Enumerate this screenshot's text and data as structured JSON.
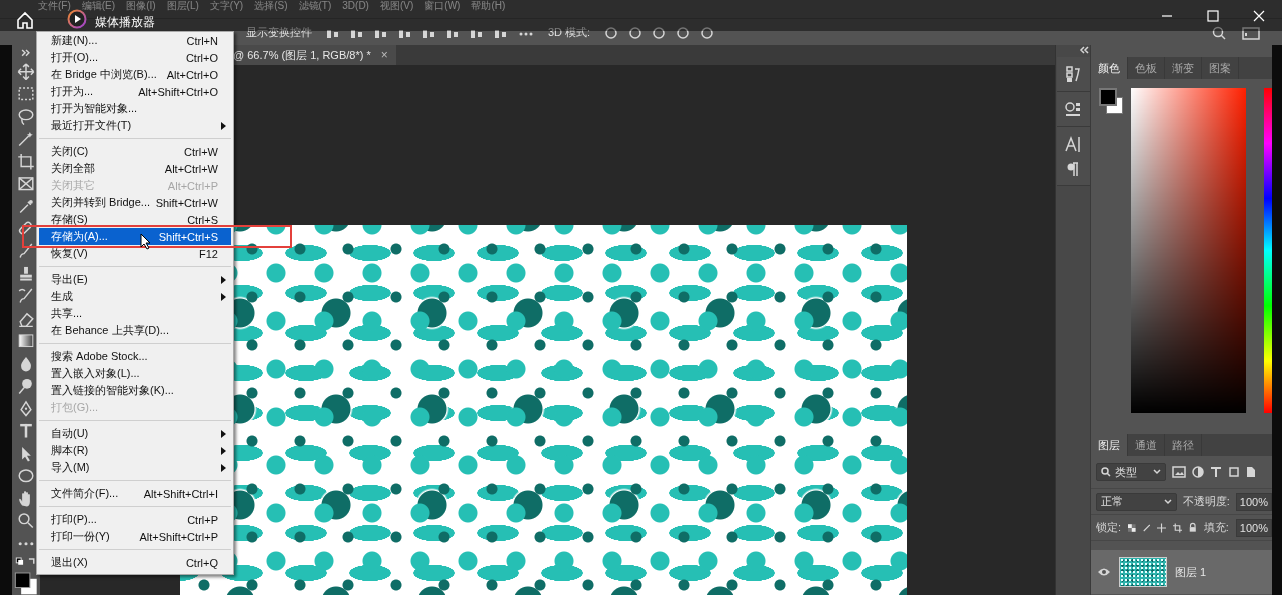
{
  "menubar": [
    {
      "label": "文件(F)"
    },
    {
      "label": "编辑(E)"
    },
    {
      "label": "图像(I)"
    },
    {
      "label": "图层(L)"
    },
    {
      "label": "文字(Y)"
    },
    {
      "label": "选择(S)"
    },
    {
      "label": "滤镜(T)"
    },
    {
      "label": "3D(D)"
    },
    {
      "label": "视图(V)"
    },
    {
      "label": "窗口(W)"
    },
    {
      "label": "帮助(H)"
    }
  ],
  "media_player": {
    "title": "媒体播放器"
  },
  "options_bar": {
    "transform_label": "显示变换控件",
    "mode_label": "3D 模式:"
  },
  "document_tab": {
    "title": "@ 66.7% (图层 1, RGB/8*) *",
    "close": "×"
  },
  "file_menu": {
    "items": [
      {
        "kind": "item",
        "label": "新建(N)...",
        "shortcut": "Ctrl+N",
        "disabled": false,
        "selected": false
      },
      {
        "kind": "item",
        "label": "打开(O)...",
        "shortcut": "Ctrl+O",
        "disabled": false,
        "selected": false
      },
      {
        "kind": "item",
        "label": "在 Bridge 中浏览(B)...",
        "shortcut": "Alt+Ctrl+O",
        "disabled": false,
        "selected": false
      },
      {
        "kind": "item",
        "label": "打开为...",
        "shortcut": "Alt+Shift+Ctrl+O",
        "disabled": false,
        "selected": false
      },
      {
        "kind": "item",
        "label": "打开为智能对象...",
        "disabled": false,
        "selected": false
      },
      {
        "kind": "submenu",
        "label": "最近打开文件(T)",
        "disabled": false,
        "selected": false
      },
      {
        "kind": "separator"
      },
      {
        "kind": "item",
        "label": "关闭(C)",
        "shortcut": "Ctrl+W",
        "disabled": false,
        "selected": false
      },
      {
        "kind": "item",
        "label": "关闭全部",
        "shortcut": "Alt+Ctrl+W",
        "disabled": false,
        "selected": false
      },
      {
        "kind": "item",
        "label": "关闭其它",
        "shortcut": "Alt+Ctrl+P",
        "disabled": true,
        "selected": false
      },
      {
        "kind": "item",
        "label": "关闭并转到 Bridge...",
        "shortcut": "Shift+Ctrl+W",
        "disabled": false,
        "selected": false
      },
      {
        "kind": "item",
        "label": "存储(S)",
        "shortcut": "Ctrl+S",
        "disabled": false,
        "selected": false
      },
      {
        "kind": "item",
        "label": "存储为(A)...",
        "shortcut": "Shift+Ctrl+S",
        "disabled": false,
        "selected": true
      },
      {
        "kind": "item",
        "label": "恢复(V)",
        "shortcut": "F12",
        "disabled": false,
        "selected": false
      },
      {
        "kind": "separator"
      },
      {
        "kind": "submenu",
        "label": "导出(E)",
        "disabled": false,
        "selected": false
      },
      {
        "kind": "submenu",
        "label": "生成",
        "disabled": false,
        "selected": false
      },
      {
        "kind": "item",
        "label": "共享...",
        "disabled": false,
        "selected": false
      },
      {
        "kind": "item",
        "label": "在 Behance 上共享(D)...",
        "disabled": false,
        "selected": false
      },
      {
        "kind": "separator"
      },
      {
        "kind": "item",
        "label": "搜索 Adobe Stock...",
        "disabled": false,
        "selected": false
      },
      {
        "kind": "item",
        "label": "置入嵌入对象(L)...",
        "disabled": false,
        "selected": false
      },
      {
        "kind": "item",
        "label": "置入链接的智能对象(K)...",
        "disabled": false,
        "selected": false
      },
      {
        "kind": "item",
        "label": "打包(G)...",
        "disabled": true,
        "selected": false
      },
      {
        "kind": "separator"
      },
      {
        "kind": "submenu",
        "label": "自动(U)",
        "disabled": false,
        "selected": false
      },
      {
        "kind": "submenu",
        "label": "脚本(R)",
        "disabled": false,
        "selected": false
      },
      {
        "kind": "submenu",
        "label": "导入(M)",
        "disabled": false,
        "selected": false
      },
      {
        "kind": "separator"
      },
      {
        "kind": "item",
        "label": "文件简介(F)...",
        "shortcut": "Alt+Shift+Ctrl+I",
        "disabled": false,
        "selected": false
      },
      {
        "kind": "separator"
      },
      {
        "kind": "item",
        "label": "打印(P)...",
        "shortcut": "Ctrl+P",
        "disabled": false,
        "selected": false
      },
      {
        "kind": "item",
        "label": "打印一份(Y)",
        "shortcut": "Alt+Shift+Ctrl+P",
        "disabled": false,
        "selected": false
      },
      {
        "kind": "separator"
      },
      {
        "kind": "item",
        "label": "退出(X)",
        "shortcut": "Ctrl+Q",
        "disabled": false,
        "selected": false
      }
    ]
  },
  "color_panel": {
    "tabs": [
      {
        "label": "颜色",
        "selected": true
      },
      {
        "label": "色板",
        "selected": false
      },
      {
        "label": "渐变",
        "selected": false
      },
      {
        "label": "图案",
        "selected": false
      }
    ]
  },
  "layers_panel": {
    "tabs": [
      {
        "label": "图层",
        "selected": true
      },
      {
        "label": "通道",
        "selected": false
      },
      {
        "label": "路径",
        "selected": false
      }
    ],
    "filter": "类型",
    "blend_mode": "正常",
    "opacity_label": "不透明度:",
    "opacity": "100%",
    "lock_label": "锁定:",
    "fill_label": "填充:",
    "fill": "100%",
    "layers": [
      {
        "name": "图层 1",
        "visible": true
      }
    ]
  }
}
